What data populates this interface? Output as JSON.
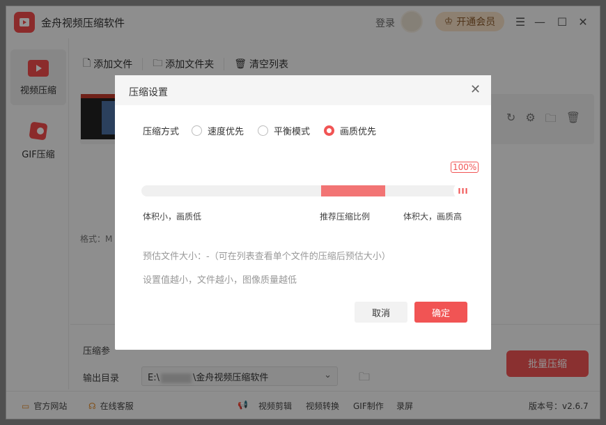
{
  "app": {
    "title": "金舟视频压缩软件",
    "login": "登录",
    "vip": "开通会员",
    "window_controls": [
      "menu-icon",
      "minimize-icon",
      "maximize-icon",
      "close-icon"
    ]
  },
  "sidebar": {
    "items": [
      {
        "label": "视频压缩",
        "icon": "video-play-icon",
        "active": true
      },
      {
        "label": "GIF压缩",
        "icon": "gif-image-icon",
        "active": false
      }
    ]
  },
  "toolbar": {
    "add_file": "添加文件",
    "add_folder": "添加文件夹",
    "clear_list": "清空列表"
  },
  "file_row": {
    "format_label": "格式：M"
  },
  "bottom": {
    "compress_params": "压缩参",
    "output_dir_label": "输出目录",
    "output_path_prefix": "E:\\",
    "output_path_suffix": "\\金舟视频压缩软件",
    "batch_button": "批量压缩"
  },
  "footer": {
    "website": "官方网站",
    "support": "在线客服",
    "links": [
      "视频剪辑",
      "视频转换",
      "GIF制作",
      "录屏"
    ],
    "version": "版本号：v2.6.7"
  },
  "dialog": {
    "title": "压缩设置",
    "mode_label": "压缩方式",
    "options": [
      {
        "label": "速度优先",
        "selected": false
      },
      {
        "label": "平衡模式",
        "selected": false
      },
      {
        "label": "画质优先",
        "selected": true
      }
    ],
    "slider": {
      "percent_label": "100%",
      "value": 1.0
    },
    "left_label": "体积小，画质低",
    "mid_label": "推荐压缩比例",
    "right_label": "体积大，画质高",
    "estimate_text": "预估文件大小：-（可在列表查看单个文件的压缩后预估大小）",
    "hint_text": "设置值越小，文件越小，图像质量越低",
    "cancel": "取消",
    "confirm": "确定"
  },
  "colors": {
    "accent": "#f15454",
    "vip_bg": "#f3ddc3"
  }
}
